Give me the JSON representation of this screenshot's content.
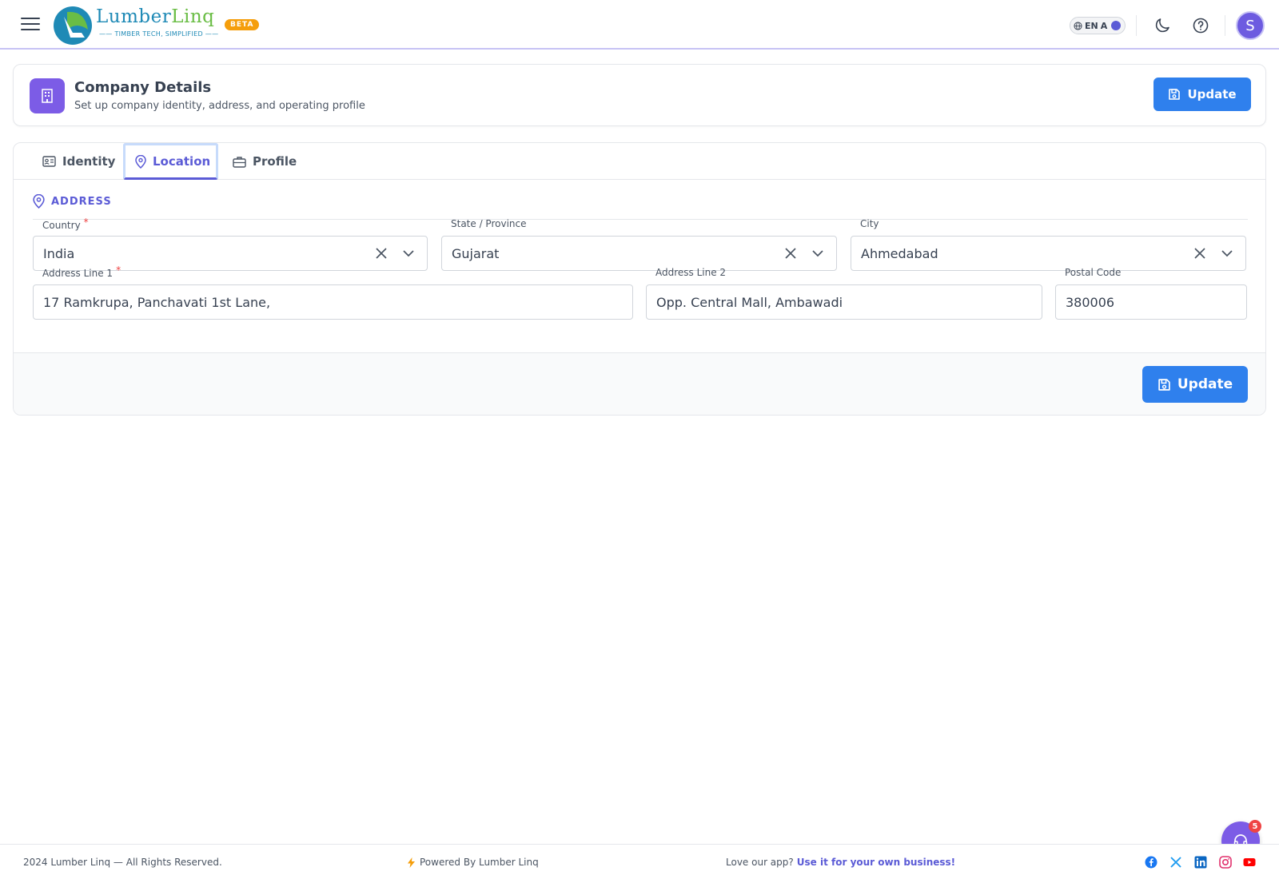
{
  "app": {
    "brand_main": "LumberLinq",
    "brand_prefix": "Lumber",
    "brand_suffix": "Linq",
    "tagline": "—— TIMBER TECH, SIMPLIFIED ——",
    "badge": "BETA",
    "language": "EN",
    "language_script": "A",
    "user_initial": "S",
    "icons": [
      "menu-icon",
      "globe-icon",
      "moon-icon",
      "help-icon"
    ]
  },
  "header": {
    "title": "Company Details",
    "subtitle": "Set up company identity, address, and operating profile",
    "update_label": "Update",
    "icon": "building-icon"
  },
  "tabs": [
    {
      "label": "Identity",
      "icon": "id-card-icon",
      "active": false
    },
    {
      "label": "Location",
      "icon": "map-pin-icon",
      "active": true
    },
    {
      "label": "Profile",
      "icon": "briefcase-icon",
      "active": false
    }
  ],
  "address": {
    "section_title": "ADDRESS",
    "country": {
      "label": "Country",
      "required": "*",
      "value": "India"
    },
    "state": {
      "label": "State / Province",
      "value": "Gujarat"
    },
    "city": {
      "label": "City",
      "value": "Ahmedabad"
    },
    "line1": {
      "label": "Address Line 1",
      "required": "*",
      "value": "17 Ramkrupa, Panchavati 1st Lane,"
    },
    "line2": {
      "label": "Address Line 2",
      "value": "Opp. Central Mall, Ambawadi"
    },
    "postal": {
      "label": "Postal Code",
      "value": "380006"
    }
  },
  "form_footer": {
    "update_label": "Update"
  },
  "footer": {
    "copyright": "2024 Lumber Linq — All Rights Reserved.",
    "powered": "Powered By Lumber Linq",
    "love_text": "Love our app?",
    "love_link": "Use it for your own business!",
    "social": [
      "facebook-icon",
      "x-icon",
      "linkedin-icon",
      "instagram-icon",
      "youtube-icon"
    ]
  },
  "support": {
    "badge_count": "5"
  },
  "colors": {
    "accent": "#5b5bd6",
    "primary_button": "#2f80ed",
    "header_icon_bg": "#7c5ce6",
    "beta": "#f59e0b",
    "required": "#ef4444"
  }
}
